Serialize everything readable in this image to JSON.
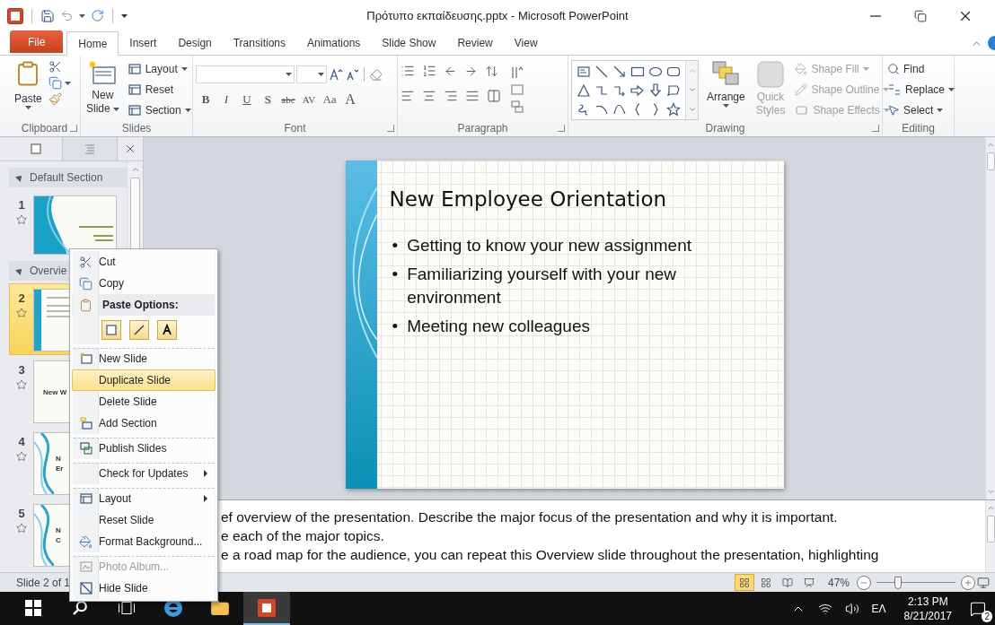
{
  "window": {
    "title": "Πρότυπο εκπαίδευσης.pptx - Microsoft PowerPoint"
  },
  "ribbon_tabs": [
    {
      "label": "File",
      "kind": "file",
      "selected": false
    },
    {
      "label": "Home",
      "kind": "tab",
      "selected": true
    },
    {
      "label": "Insert",
      "kind": "tab",
      "selected": false
    },
    {
      "label": "Design",
      "kind": "tab",
      "selected": false
    },
    {
      "label": "Transitions",
      "kind": "tab",
      "selected": false
    },
    {
      "label": "Animations",
      "kind": "tab",
      "selected": false
    },
    {
      "label": "Slide Show",
      "kind": "tab",
      "selected": false
    },
    {
      "label": "Review",
      "kind": "tab",
      "selected": false
    },
    {
      "label": "View",
      "kind": "tab",
      "selected": false
    }
  ],
  "clipboard_group": {
    "paste": "Paste",
    "label": "Clipboard"
  },
  "slides_group": {
    "new_slide": [
      "New",
      "Slide"
    ],
    "buttons": [
      {
        "label": "Layout",
        "has_menu": true
      },
      {
        "label": "Reset",
        "has_menu": false
      },
      {
        "label": "Section",
        "has_menu": true
      }
    ],
    "label": "Slides"
  },
  "font_group": {
    "buttons": [
      {
        "label": "B",
        "kind": "bold"
      },
      {
        "label": "I",
        "kind": "italic"
      },
      {
        "label": "U",
        "kind": "underline"
      },
      {
        "label": "S",
        "kind": "shadow"
      },
      {
        "label": "abc",
        "kind": "strike"
      },
      {
        "label": "AV",
        "kind": "spacing"
      },
      {
        "label": "Aa",
        "kind": "case"
      },
      {
        "label": "A",
        "kind": "color"
      }
    ],
    "label": "Font"
  },
  "paragraph_group": {
    "label": "Paragraph"
  },
  "drawing_group": {
    "arrange": "Arrange",
    "quick_styles": {
      "label": "Quick Styles",
      "disabled": true
    },
    "shape_buttons": [
      {
        "label": "Shape Fill",
        "disabled": true
      },
      {
        "label": "Shape Outline",
        "disabled": true
      },
      {
        "label": "Shape Effects",
        "disabled": true
      }
    ],
    "label": "Drawing"
  },
  "editing_group": {
    "buttons": [
      {
        "label": "Find",
        "has_menu": false
      },
      {
        "label": "Replace",
        "has_menu": true
      },
      {
        "label": "Select",
        "has_menu": true
      }
    ],
    "label": "Editing"
  },
  "slide_panel": {
    "sections": [
      {
        "title": "Default Section",
        "expanded": true,
        "slides": [
          {
            "number": "1",
            "selected": false
          }
        ]
      },
      {
        "title": "Overvie",
        "expanded": true,
        "slides": [
          {
            "number": "2",
            "selected": true
          },
          {
            "number": "3",
            "selected": false,
            "title_lines": [
              "New W"
            ]
          },
          {
            "number": "4",
            "selected": false,
            "title_lines": [
              "N",
              "Er"
            ]
          },
          {
            "number": "5",
            "selected": false,
            "title_lines": [
              "N",
              "C"
            ]
          }
        ]
      }
    ]
  },
  "slide": {
    "title": "New Employee Orientation",
    "bullets": [
      {
        "marker": "•",
        "text": "Getting to know your new assignment"
      },
      {
        "marker": "•",
        "text": "Familiarizing yourself with your new environment"
      },
      {
        "marker": "•",
        "text": "Meeting new colleagues"
      }
    ]
  },
  "notes": [
    "ef overview of the presentation. Describe the major focus of the presentation and why it is important.",
    "e each of the major topics.",
    "e a road map for the audience, you can repeat this Overview slide throughout the presentation, highlighting"
  ],
  "status_bar": {
    "slide_counter": "Slide 2 of 1",
    "views": [
      {
        "selected": true
      },
      {
        "selected": false
      },
      {
        "selected": false
      },
      {
        "selected": false
      }
    ],
    "zoom": "47%",
    "zoom_slider": {
      "level": 0.27
    }
  },
  "context_menu": [
    {
      "kind": "item",
      "label": "Cut",
      "selected": false,
      "disabled": false,
      "submenu": false,
      "separator_before": false
    },
    {
      "kind": "item",
      "label": "Copy",
      "selected": false,
      "disabled": false,
      "submenu": false,
      "separator_before": false
    },
    {
      "kind": "header",
      "label": "Paste Options:",
      "selected": false,
      "disabled": false,
      "submenu": false,
      "separator_before": false
    },
    {
      "kind": "paste_options",
      "selected": false,
      "disabled": false,
      "submenu": false,
      "separator_before": false
    },
    {
      "kind": "item",
      "label": "New Slide",
      "selected": false,
      "disabled": false,
      "submenu": false,
      "separator_before": true
    },
    {
      "kind": "item",
      "label": "Duplicate Slide",
      "selected": true,
      "disabled": false,
      "submenu": false,
      "separator_before": false
    },
    {
      "kind": "item",
      "label": "Delete Slide",
      "selected": false,
      "disabled": false,
      "submenu": false,
      "separator_before": false
    },
    {
      "kind": "item",
      "label": "Add Section",
      "selected": false,
      "disabled": false,
      "submenu": false,
      "separator_before": false
    },
    {
      "kind": "item",
      "label": "Publish Slides",
      "selected": false,
      "disabled": false,
      "submenu": false,
      "separator_before": true
    },
    {
      "kind": "item",
      "label": "Check for Updates",
      "selected": false,
      "disabled": false,
      "submenu": true,
      "separator_before": true
    },
    {
      "kind": "item",
      "label": "Layout",
      "selected": false,
      "disabled": false,
      "submenu": true,
      "separator_before": true
    },
    {
      "kind": "item",
      "label": "Reset Slide",
      "selected": false,
      "disabled": false,
      "submenu": false,
      "separator_before": false
    },
    {
      "kind": "item",
      "label": "Format Background...",
      "selected": false,
      "disabled": false,
      "submenu": false,
      "separator_before": false
    },
    {
      "kind": "item",
      "label": "Photo Album...",
      "selected": false,
      "disabled": true,
      "submenu": false,
      "separator_before": true
    },
    {
      "kind": "item",
      "label": "Hide Slide",
      "selected": false,
      "disabled": false,
      "submenu": false,
      "separator_before": false
    }
  ],
  "taskbar": {
    "apps": [
      {
        "selected": false
      },
      {
        "selected": false
      },
      {
        "selected": true
      }
    ],
    "tray": {
      "language": "ΕΛ",
      "time": "2:13 PM",
      "date": "8/21/2017",
      "notifications": "2"
    }
  }
}
